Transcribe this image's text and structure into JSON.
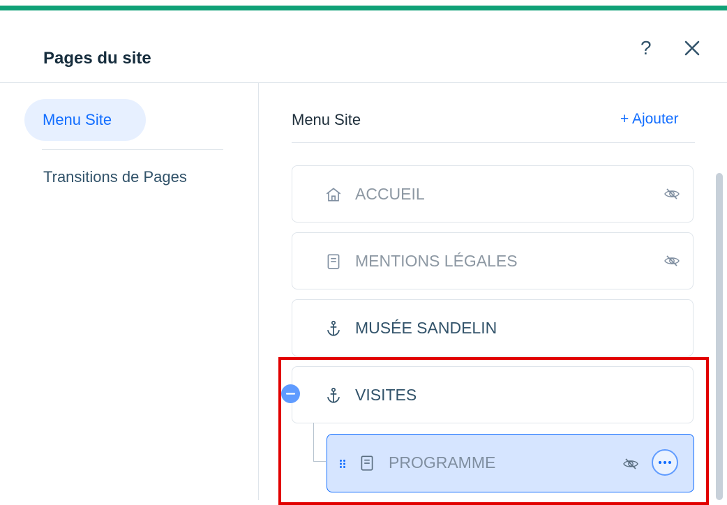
{
  "header": {
    "title": "Pages du site",
    "help_label": "?"
  },
  "sidebar": {
    "items": [
      {
        "label": "Menu Site"
      },
      {
        "label": "Transitions de Pages"
      }
    ]
  },
  "main": {
    "section_title": "Menu Site",
    "add_label": "+ Ajouter",
    "pages": [
      {
        "label": "ACCUEIL",
        "icon": "home-icon",
        "visibility": "hidden"
      },
      {
        "label": "MENTIONS LÉGALES",
        "icon": "page-icon",
        "visibility": "hidden"
      },
      {
        "label": "MUSÉE SANDELIN",
        "icon": "anchor-icon",
        "visibility": "visible"
      },
      {
        "label": "VISITES",
        "icon": "anchor-icon",
        "visibility": "visible"
      }
    ],
    "subpage": {
      "label": "PROGRAMME",
      "icon": "page-icon",
      "visibility": "hidden"
    }
  },
  "colors": {
    "accent": "#116dff",
    "green": "#10a177",
    "highlight": "#e10000"
  }
}
